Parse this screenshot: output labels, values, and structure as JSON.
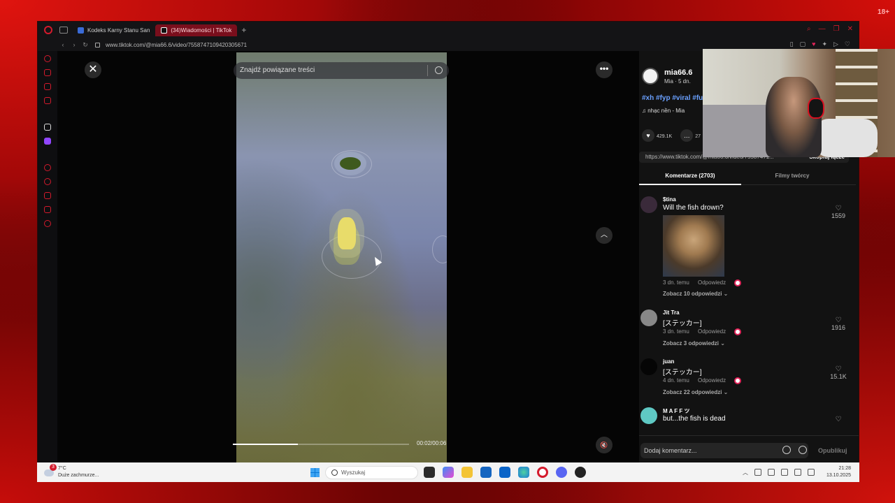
{
  "overlay": {
    "age_badge": "18+"
  },
  "browser": {
    "tabs": [
      {
        "label": "Kodeks Karny Stanu San",
        "active": false
      },
      {
        "label": "(34)Wiadomości | TikTok",
        "active": true
      }
    ],
    "url": "www.tiktok.com/@mia66.6/video/7558747109420305671"
  },
  "video": {
    "search_placeholder": "Znajdź powiązane treści",
    "time": "00:02/00:06",
    "progress_fraction": 0.37
  },
  "post": {
    "author": "mia66.6",
    "author_sub": "Mia · 5 dn.",
    "hashtags": "#xh #fyp #viral #fu",
    "music": "♫ nhạc nền - Mia",
    "likes": "429.1K",
    "comments_count": "27",
    "link": "https://www.tiktok.com/@mia66.6/video/75587471...",
    "copy_label": "Skopiuj łącze",
    "tab_comments": "Komentarze (2703)",
    "tab_creator": "Filmy twórcy"
  },
  "comments": [
    {
      "name": "$tina",
      "text": "Will the fish drown?",
      "time": "3 dn. temu",
      "reply": "Odpowiedz",
      "replies": "Zobacz 10 odpowiedzi ⌄",
      "likes": "1559"
    },
    {
      "name": "Jit Tra",
      "text": "[ステッカー]",
      "time": "3 dn. temu",
      "reply": "Odpowiedz",
      "replies": "Zobacz 3 odpowiedzi ⌄",
      "likes": "1916"
    },
    {
      "name": "juan",
      "text": "[ステッカー]",
      "time": "4 dn. temu",
      "reply": "Odpowiedz",
      "replies": "Zobacz 22 odpowiedzi ⌄",
      "likes": "15.1K"
    },
    {
      "name": "M A F F ツ",
      "text": "but...the fish is dead",
      "time": "",
      "reply": "",
      "replies": "",
      "likes": ""
    }
  ],
  "add_comment": {
    "placeholder": "Dodaj komentarz...",
    "publish": "Opublikuj"
  },
  "taskbar": {
    "weather_temp": "7°C",
    "weather_desc": "Duże zachmurze...",
    "weather_badge": "3",
    "search": "Wyszukaj",
    "time": "21:28",
    "date": "13.10.2025"
  }
}
